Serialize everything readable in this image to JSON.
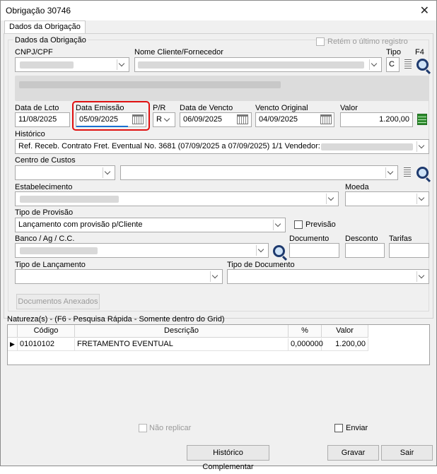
{
  "window": {
    "title": "Obrigação 30746",
    "close_glyph": "✕"
  },
  "tabs": [
    {
      "label": "Dados da Obrigação"
    }
  ],
  "group": {
    "title": "Dados da Obrigação",
    "retem_ultimo_registro": "Retém o último registro",
    "f4_label": "F4"
  },
  "labels": {
    "cnpj": "CNPJ/CPF",
    "nome_cliente": "Nome Cliente/Fornecedor",
    "tipo": "Tipo",
    "data_lcto": "Data de Lcto",
    "data_emissao": "Data Emissão",
    "pr": "P/R",
    "data_vencto": "Data de Vencto",
    "vencto_original": "Vencto Original",
    "valor": "Valor",
    "historico": "Histórico",
    "centro_custos": "Centro de Custos",
    "estabelecimento": "Estabelecimento",
    "moeda": "Moeda",
    "tipo_provisao": "Tipo de Provisão",
    "previsao": "Previsão",
    "banco": "Banco / Ag / C.C.",
    "documento": "Documento",
    "desconto": "Desconto",
    "tarifas": "Tarifas",
    "tipo_lancamento": "Tipo de Lançamento",
    "tipo_documento": "Tipo de Documento"
  },
  "fields": {
    "tipo_value": "C",
    "data_lcto": "11/08/2025",
    "data_emissao": "05/09/2025",
    "pr_value": "R",
    "data_vencto": "06/09/2025",
    "vencto_original": "04/09/2025",
    "valor": "1.200,00",
    "historico": "Ref. Receb. Contrato Fret. Eventual No. 3681  (07/09/2025 a 07/09/2025) 1/1 Vendedor:",
    "tipo_provisao": "Lançamento com provisão p/Cliente"
  },
  "buttons": {
    "documentos_anexados": "Documentos Anexados",
    "historico_complementar": "Histórico Complementar",
    "gravar": "Gravar",
    "sair": "Sair"
  },
  "naturezas": {
    "caption": "Natureza(s) - (F6 - Pesquisa Rápida - Somente dentro do Grid)",
    "columns": [
      "Código",
      "Descrição",
      "%",
      "Valor"
    ],
    "rows": [
      {
        "codigo": "01010102",
        "descricao": "FRETAMENTO EVENTUAL",
        "pct": "0,000000",
        "valor": "1.200,00"
      }
    ]
  },
  "footer": {
    "nao_replicar": "Não replicar",
    "enviar": "Enviar"
  },
  "colors": {
    "focus_highlight": "#e01010",
    "calculator_green": "#2e8b2e"
  }
}
